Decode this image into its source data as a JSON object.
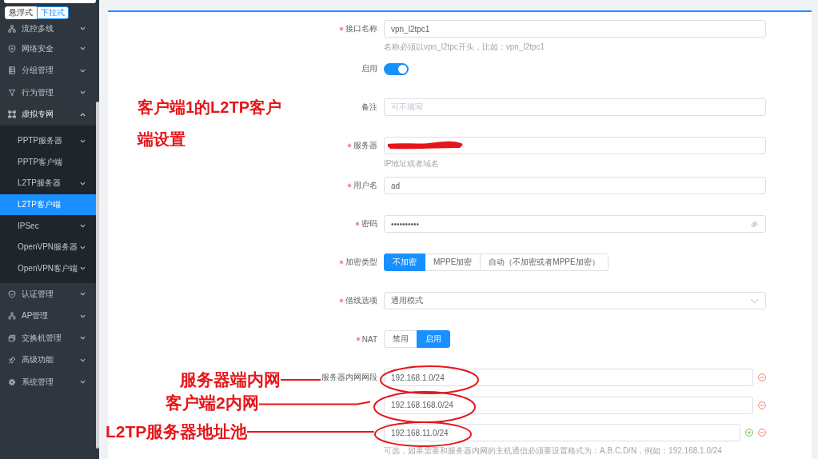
{
  "sidebar": {
    "mode_toggle": [
      {
        "label": "悬浮式",
        "selected": false
      },
      {
        "label": "下拉式",
        "selected": true
      }
    ],
    "menu": [
      {
        "label": "流控多线",
        "expanded": false
      },
      {
        "label": "网络安全",
        "expanded": false
      },
      {
        "label": "分组管理",
        "expanded": false
      },
      {
        "label": "行为管理",
        "expanded": false
      },
      {
        "label": "虚拟专网",
        "expanded": true,
        "children": [
          {
            "label": "PPTP服务器",
            "kind": "group",
            "selected": false
          },
          {
            "label": "PPTP客户端",
            "kind": "page",
            "selected": false
          },
          {
            "label": "L2TP服务器",
            "kind": "group",
            "selected": false
          },
          {
            "label": "L2TP客户端",
            "kind": "page",
            "selected": true
          },
          {
            "label": "IPSec",
            "kind": "group",
            "selected": false
          },
          {
            "label": "OpenVPN服务器",
            "kind": "group",
            "selected": false
          },
          {
            "label": "OpenVPN客户端",
            "kind": "group",
            "selected": false
          }
        ]
      },
      {
        "label": "认证管理",
        "expanded": false
      },
      {
        "label": "AP管理",
        "expanded": false
      },
      {
        "label": "交换机管理",
        "expanded": false
      },
      {
        "label": "高级功能",
        "expanded": false
      },
      {
        "label": "系统管理",
        "expanded": false
      }
    ]
  },
  "form": {
    "fields": [
      {
        "kind": "text",
        "label": "接口名称",
        "required": true,
        "value": "vpn_l2tpc1",
        "hint": "名称必须以vpn_l2tpc开头，比如：vpn_l2tpc1"
      },
      {
        "kind": "switch",
        "label": "启用",
        "required": false,
        "on": true
      },
      {
        "kind": "text",
        "label": "备注",
        "required": false,
        "placeholder": "可不填写"
      },
      {
        "kind": "text",
        "label": "服务器",
        "required": true,
        "redacted": true,
        "hint": "IP地址或者域名"
      },
      {
        "kind": "text",
        "label": "用户名",
        "required": true,
        "value": "ad"
      },
      {
        "kind": "password",
        "label": "密码",
        "required": true,
        "value": "••••••••••"
      },
      {
        "kind": "radio",
        "label": "加密类型",
        "required": true,
        "options": [
          {
            "label": "不加密",
            "selected": true
          },
          {
            "label": "MPPE加密",
            "selected": false
          },
          {
            "label": "自动（不加密或者MPPE加密）",
            "selected": false
          }
        ]
      },
      {
        "kind": "select",
        "label": "借线选项",
        "required": true,
        "value": "通用模式"
      },
      {
        "kind": "radio",
        "label": "NAT",
        "required": true,
        "options": [
          {
            "label": "禁用",
            "selected": false
          },
          {
            "label": "启用",
            "selected": true
          }
        ]
      },
      {
        "kind": "list",
        "label": "服务器内网网段",
        "required": false,
        "items": [
          {
            "value": "192.168.1.0/24",
            "addable": false,
            "removable": true
          },
          {
            "value": "192.168.168.0/24",
            "addable": false,
            "removable": true
          },
          {
            "value": "192.168.11.0/24",
            "addable": true,
            "removable": true
          }
        ],
        "hint": "可选，如果需要和服务器内网的主机通信必须要设置格式为：A.B.C.D/N，例如：192.168.1.0/24"
      }
    ]
  },
  "annotations": {
    "title": "客户端1的L2TP客户端设置",
    "callouts": [
      {
        "text": "服务器端内网"
      },
      {
        "text": "客户端2内网"
      },
      {
        "text": "L2TP服务器地址池"
      }
    ]
  }
}
